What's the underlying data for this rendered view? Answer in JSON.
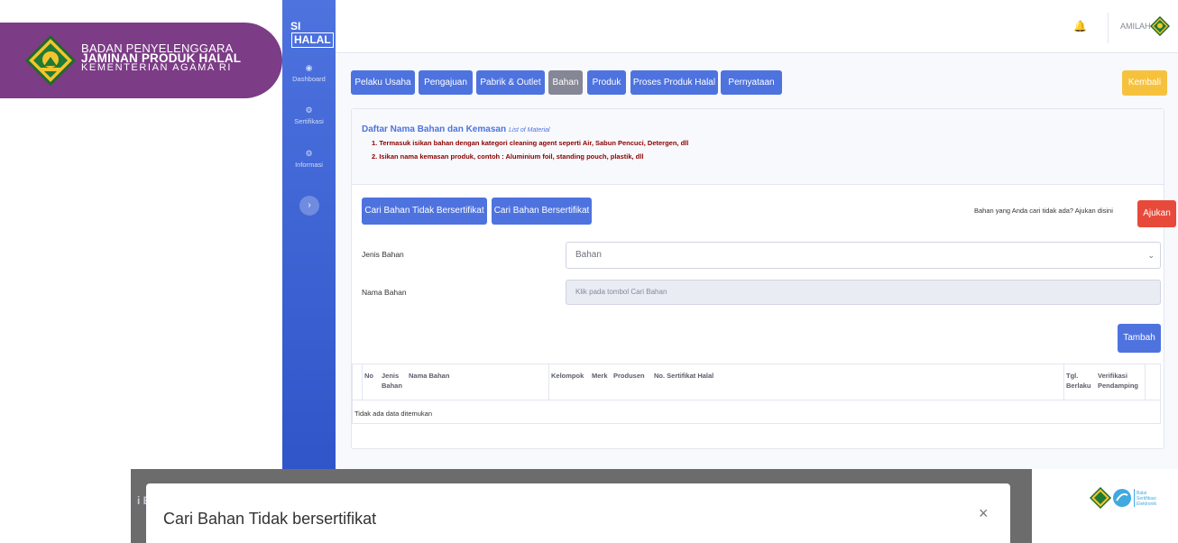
{
  "brand": {
    "line1": "BADAN PENYELENGGARA",
    "line2": "JAMINAN PRODUK HALAL",
    "line3": "KEMENTERIAN AGAMA RI"
  },
  "sidebar": {
    "logo_prefix": "SI",
    "logo_main": "HALAL",
    "items": [
      {
        "label": "Dashboard",
        "icon": "dashboard-icon"
      },
      {
        "label": "Sertifikasi",
        "icon": "gear-icon"
      },
      {
        "label": "Informasi",
        "icon": "gear-icon"
      }
    ],
    "toggle_icon": "chevron-right-icon"
  },
  "topbar": {
    "username": "AMILAH",
    "bell_icon": "bell-icon"
  },
  "tabs": [
    {
      "label": "Pelaku Usaha"
    },
    {
      "label": "Pengajuan"
    },
    {
      "label": "Pabrik & Outlet"
    },
    {
      "label": "Bahan",
      "active": true
    },
    {
      "label": "Produk"
    },
    {
      "label": "Proses Produk Halal"
    },
    {
      "label": "Pernyataan"
    }
  ],
  "kembali_label": "Kembali",
  "card": {
    "title": "Daftar Nama Bahan dan Kemasan",
    "title_sub": "List of Material",
    "notes": [
      "1. Termasuk isikan bahan dengan kategori cleaning agent seperti Air, Sabun Pencuci, Detergen, dll",
      "2. Isikan nama kemasan produk, contoh : Aluminium foil, standing pouch, plastik, dll"
    ]
  },
  "search": {
    "btn_tidak": "Cari Bahan Tidak Bersertifikat",
    "btn_bersertifikat": "Cari Bahan Bersertifikat",
    "ajukan_text": "Bahan yang Anda cari tidak ada? Ajukan disini",
    "ajukan_label": "Ajukan"
  },
  "form": {
    "jenis_label": "Jenis Bahan",
    "jenis_value": "Bahan",
    "nama_label": "Nama Bahan",
    "nama_placeholder": "Klik pada tombol Cari Bahan",
    "tambah_label": "Tambah"
  },
  "table": {
    "headers": {
      "no": "No",
      "jenis1": "Jenis",
      "jenis2": "Bahan",
      "nama": "Nama Bahan",
      "kelompok": "Kelompok",
      "merk": "Merk",
      "produsen": "Produsen",
      "sertifikat": "No. Sertifikat Halal",
      "tgl1": "Tgl.",
      "tgl2": "Berlaku",
      "ver1": "Verifikasi",
      "ver2": "Pendamping"
    },
    "empty_text": "Tidak ada data ditemukan"
  },
  "modal": {
    "title": "Cari Bahan Tidak bersertifikat",
    "close": "×",
    "partial_edge": "i E"
  },
  "footer": {
    "logo_text": "Balai Sertifikasi Elektronik"
  },
  "colors": {
    "primary": "#4e73df",
    "brand_purple": "#7c3c86",
    "danger": "#e74a3b",
    "warning": "#f6c23e",
    "note_red": "#8b0000"
  }
}
